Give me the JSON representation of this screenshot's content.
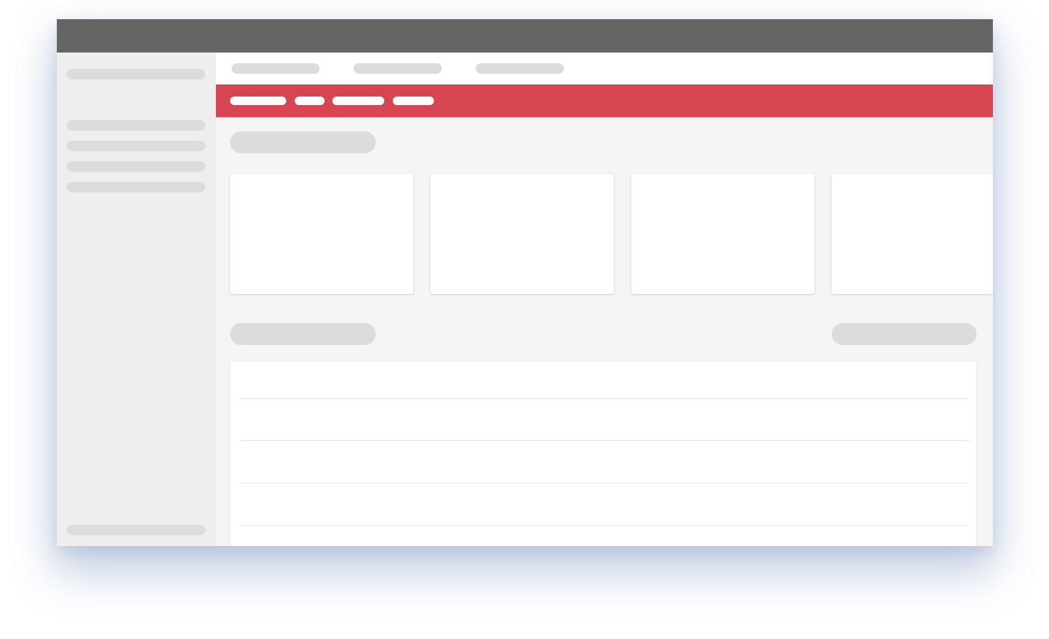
{
  "window": {
    "title": ""
  },
  "sidebar": {
    "header_label": "",
    "items": [
      {
        "label": ""
      },
      {
        "label": ""
      },
      {
        "label": ""
      },
      {
        "label": ""
      }
    ],
    "footer_label": ""
  },
  "top_nav": {
    "tabs": [
      {
        "label": ""
      },
      {
        "label": ""
      },
      {
        "label": ""
      }
    ]
  },
  "sub_nav": {
    "items": [
      {
        "label": ""
      },
      {
        "label": ""
      },
      {
        "label": ""
      },
      {
        "label": ""
      }
    ]
  },
  "main": {
    "section_title": "",
    "cards": [
      {
        "label": ""
      },
      {
        "label": ""
      },
      {
        "label": ""
      },
      {
        "label": ""
      }
    ],
    "list_title": "",
    "list_action_label": "",
    "rows": [
      {
        "label": ""
      },
      {
        "label": ""
      },
      {
        "label": ""
      },
      {
        "label": ""
      }
    ]
  },
  "colors": {
    "titlebar": "#656565",
    "accent": "#d64550",
    "sidebar_bg": "#eeeeee",
    "content_bg": "#f5f5f5",
    "placeholder": "#dcdcdc"
  }
}
